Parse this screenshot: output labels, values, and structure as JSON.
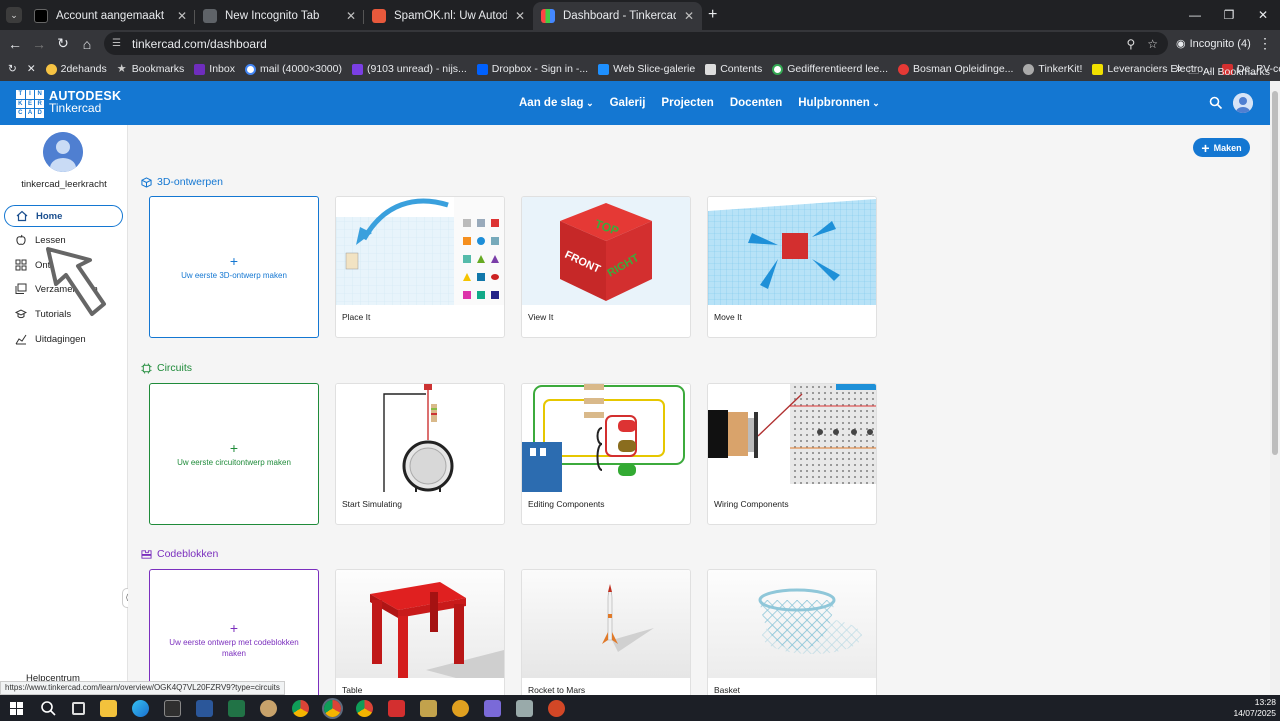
{
  "browser": {
    "tabs": [
      {
        "title": "Account aangemaakt",
        "favicon_color": "#000000",
        "active": false
      },
      {
        "title": "New Incognito Tab",
        "favicon_color": "#5f6368",
        "active": false
      },
      {
        "title": "SpamOK.nl: Uw Autodesk-acco",
        "favicon_color": "#e8593c",
        "active": false
      },
      {
        "title": "Dashboard - Tinkercad",
        "favicon_color": "#1477d2",
        "active": true
      }
    ],
    "url": "tinkercad.com/dashboard",
    "incognito_label": "Incognito (4)",
    "bookmarks": [
      {
        "label": "2dehands",
        "color": "#f6c343"
      },
      {
        "label": "Bookmarks",
        "color": "#bbbbbb"
      },
      {
        "label": "Inbox",
        "color": "#6f2dbd"
      },
      {
        "label": "mail (4000×3000)",
        "color": "#4285f4"
      },
      {
        "label": "(9103 unread) - nijs...",
        "color": "#7b3fe4"
      },
      {
        "label": "Dropbox - Sign in -...",
        "color": "#0061fe"
      },
      {
        "label": "Web Slice-galerie",
        "color": "#1e90ff"
      },
      {
        "label": "Contents",
        "color": "#dddddd"
      },
      {
        "label": "Gedifferentieerd lee...",
        "color": "#4285f4"
      },
      {
        "label": "Bosman Opleidinge...",
        "color": "#e53935"
      },
      {
        "label": "TinkerKit!",
        "color": "#aaaaaa"
      },
      {
        "label": "Leveranciers Electro...",
        "color": "#f0e000"
      },
      {
        "label": "De_PV-cel_I-V_curv...",
        "color": "#d32f2f"
      }
    ],
    "all_bookmarks": "All Bookmarks",
    "status_url": "https://www.tinkercad.com/learn/overview/OGK4Q7VL20FZRV9?type=circuits"
  },
  "header": {
    "brand_line1": "AUTODESK",
    "brand_line2": "Tinkercad",
    "logo_letters": [
      "TIN",
      "KER",
      "CAD"
    ],
    "nav": [
      "Aan de slag",
      "Galerij",
      "Projecten",
      "Docenten",
      "Hulpbronnen"
    ],
    "accent_color": "#1477d2"
  },
  "sidebar": {
    "username": "tinkercad_leerkracht",
    "items": [
      "Home",
      "Lessen",
      "Ontwerpen",
      "Verzamelingen",
      "Tutorials",
      "Uitdagingen"
    ],
    "help": "Helpcentrum"
  },
  "main": {
    "maken": "Maken",
    "sections": [
      {
        "title": "3D-ontwerpen",
        "color": "#1477d2",
        "new_label": "Uw eerste 3D-ontwerp maken",
        "cards": [
          "Place It",
          "View It",
          "Move It"
        ]
      },
      {
        "title": "Circuits",
        "color": "#1f8b3a",
        "new_label": "Uw eerste circuitontwerp maken",
        "cards": [
          "Start Simulating",
          "Editing Components",
          "Wiring Components"
        ]
      },
      {
        "title": "Codeblokken",
        "color": "#7b2fbe",
        "new_label": "Uw eerste ontwerp met codeblokken maken",
        "cards": [
          "Table",
          "Rocket to Mars",
          "Basket"
        ]
      }
    ],
    "cube_faces": {
      "top": "TOP",
      "front": "FRONT",
      "right": "RIGHT"
    }
  },
  "taskbar": {
    "time": "13:28",
    "date": "14/07/2025"
  }
}
